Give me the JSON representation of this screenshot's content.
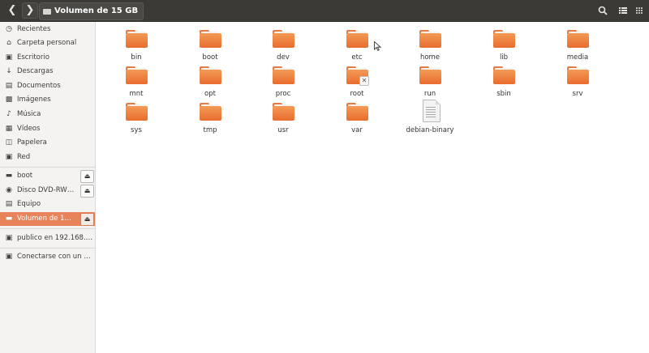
{
  "header": {
    "back_icon": "chevron-left",
    "forward_icon": "chevron-right",
    "path_label": "Volumen de 15 GB",
    "search_icon": "magnifier",
    "list_view_icon": "list",
    "grid_view_icon": "grid"
  },
  "sidebar": {
    "places": [
      {
        "label": "Recientes",
        "icon": "clock"
      },
      {
        "label": "Carpeta personal",
        "icon": "home"
      },
      {
        "label": "Escritorio",
        "icon": "desktop"
      },
      {
        "label": "Descargas",
        "icon": "download"
      },
      {
        "label": "Documentos",
        "icon": "document"
      },
      {
        "label": "Imágenes",
        "icon": "image"
      },
      {
        "label": "Música",
        "icon": "music"
      },
      {
        "label": "Vídeos",
        "icon": "video"
      },
      {
        "label": "Papelera",
        "icon": "trash"
      },
      {
        "label": "Red",
        "icon": "network"
      }
    ],
    "devices": [
      {
        "label": "boot",
        "icon": "drive",
        "eject": true
      },
      {
        "label": "Disco DVD-RW v...",
        "icon": "disc",
        "eject": true
      },
      {
        "label": "Equipo",
        "icon": "computer",
        "eject": false
      },
      {
        "label": "Volumen de 15 GB",
        "icon": "drive",
        "eject": true,
        "active": true
      }
    ],
    "network": [
      {
        "label": "publico en 192.168.1....",
        "icon": "network-share"
      }
    ],
    "other": [
      {
        "label": "Conectarse con un se...",
        "icon": "connect"
      }
    ],
    "accent_color": "#e9835b"
  },
  "files": {
    "items": [
      {
        "name": "bin",
        "type": "folder"
      },
      {
        "name": "boot",
        "type": "folder"
      },
      {
        "name": "dev",
        "type": "folder"
      },
      {
        "name": "etc",
        "type": "folder"
      },
      {
        "name": "home",
        "type": "folder"
      },
      {
        "name": "lib",
        "type": "folder"
      },
      {
        "name": "media",
        "type": "folder"
      },
      {
        "name": "mnt",
        "type": "folder"
      },
      {
        "name": "opt",
        "type": "folder"
      },
      {
        "name": "proc",
        "type": "folder"
      },
      {
        "name": "root",
        "type": "folder-locked"
      },
      {
        "name": "run",
        "type": "folder"
      },
      {
        "name": "sbin",
        "type": "folder"
      },
      {
        "name": "srv",
        "type": "folder"
      },
      {
        "name": "sys",
        "type": "folder"
      },
      {
        "name": "tmp",
        "type": "folder"
      },
      {
        "name": "usr",
        "type": "folder"
      },
      {
        "name": "var",
        "type": "folder"
      },
      {
        "name": "debian-binary",
        "type": "file"
      }
    ],
    "folder_color": "#e96c2e"
  }
}
